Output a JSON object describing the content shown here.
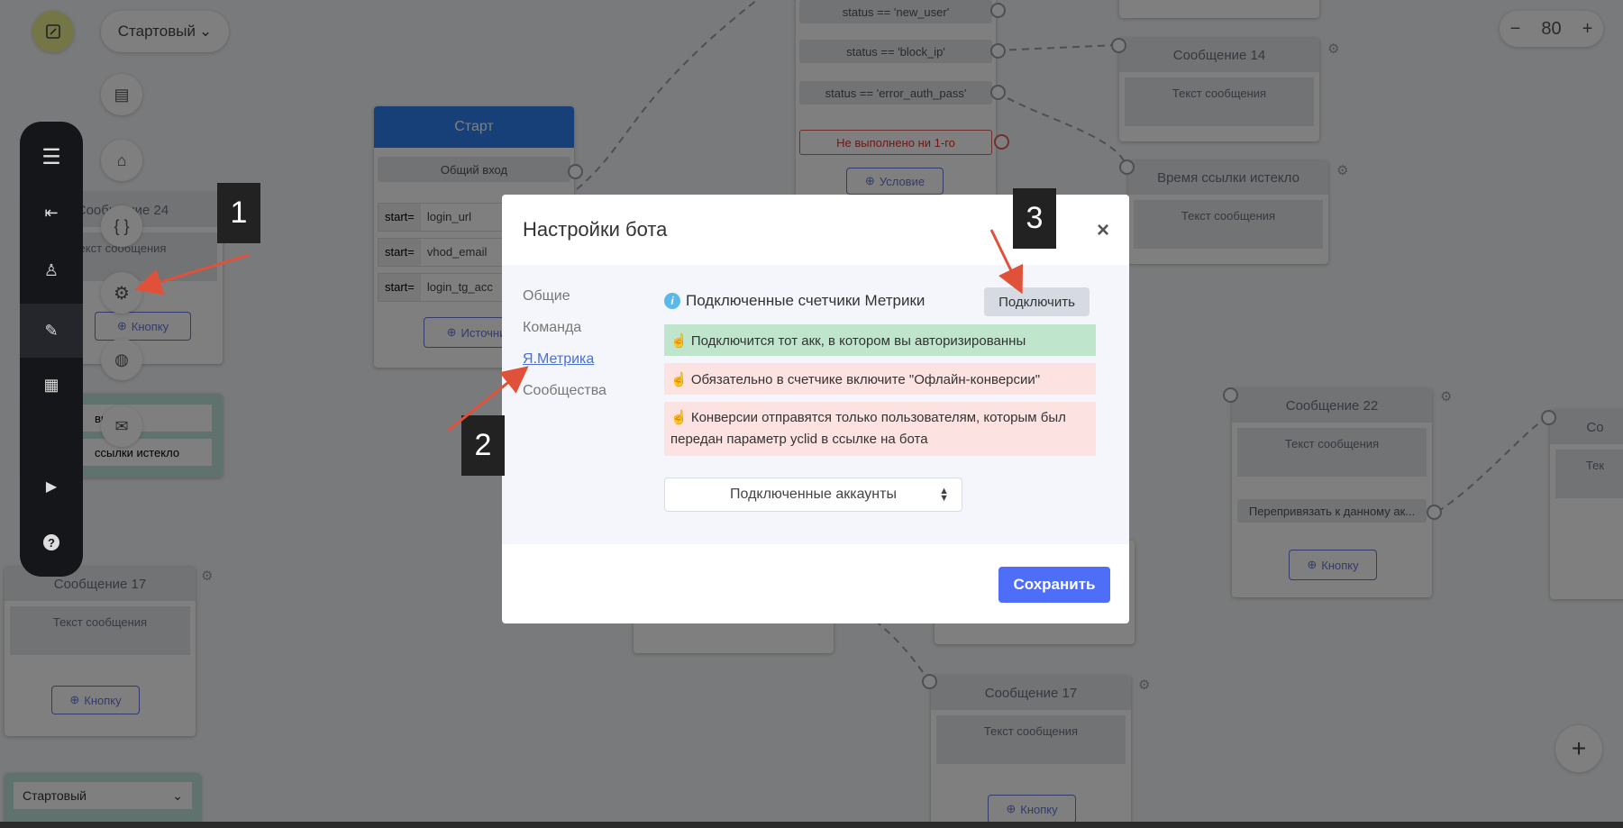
{
  "toolbar": {
    "scenario_select": "Стартовый",
    "scenario_select_bottom": "Стартовый"
  },
  "zoom": {
    "minus": "−",
    "value": "80",
    "plus": "+"
  },
  "start_node": {
    "title": "Старт",
    "general_entry": "Общий вход",
    "rows": [
      {
        "prefix": "start=",
        "value": "login_url"
      },
      {
        "prefix": "start=",
        "value": "vhod_email"
      },
      {
        "prefix": "start=",
        "value": "login_tg_acc"
      }
    ],
    "source_button": "Источни"
  },
  "conditions": {
    "items": [
      "status == 'new_user'",
      "status == 'block_ip'",
      "status == 'error_auth_pass'"
    ],
    "fail": "Не выполнено ни 1-го",
    "add_button": "Условие"
  },
  "nodes": {
    "msg24_title": "Сообщение 24",
    "msg24_text": "екст сообщения",
    "msg24_button": "Кнопку",
    "msg14_title": "Сообщение 14",
    "msg14_text": "Текст сообщения",
    "expired_title": "Время ссылки истекло",
    "expired_text": "Текст сообщения",
    "msg22_title": "Сообщение 22",
    "msg22_text": "Текст сообщения",
    "msg22_rebind": "Перепривязать к данному ак...",
    "msg22_button": "Кнопку",
    "msg17a_title": "Сообщение 17",
    "msg17a_text": "Текст сообщения",
    "msg17a_button": "Кнопку",
    "msg17b_title": "Сообщение 17",
    "msg17b_text": "Текст сообщения",
    "msg17b_button": "Кнопку",
    "teal_select1": "вый",
    "teal_select2": "ссылки истекло",
    "far_right_title": "Со",
    "far_right_text": "Тек"
  },
  "modal": {
    "title": "Настройки бота",
    "close": "×",
    "tabs": [
      "Общие",
      "Команда",
      "Я.Метрика",
      "Сообщества"
    ],
    "section_title": "Подключенные счетчики Метрики",
    "connect_button": "Подключить",
    "alerts": [
      "☝ Подключится тот акк, в котором вы авторизированны",
      "☝ Обязательно в счетчике включите \"Офлайн-конверсии\"",
      "☝ Конверсии отправятся только пользователям, которым был передан параметр yclid в ссылке на бота"
    ],
    "accounts_select": "Подключенные аккаунты",
    "save_button": "Сохранить"
  },
  "annotations": [
    "1",
    "2",
    "3"
  ],
  "colors": {
    "accent": "#4f6ef7",
    "start_header": "#2f7ff0",
    "success_bg": "#bfe6cc",
    "danger_bg": "#fde2e2",
    "annotation": "#e0513a"
  }
}
